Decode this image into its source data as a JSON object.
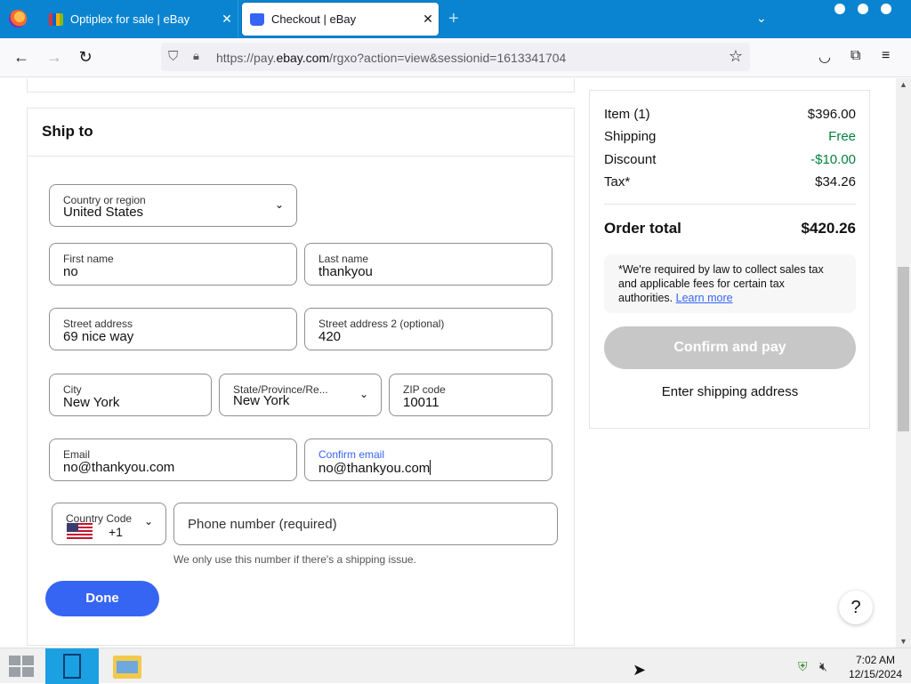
{
  "browser": {
    "tabs": [
      {
        "title": "Optiplex for sale | eBay",
        "close": "✕"
      },
      {
        "title": "Checkout | eBay",
        "close": "✕"
      }
    ],
    "new_tab": "+",
    "url_prefix": "https://pay.",
    "url_domain": "ebay.com",
    "url_suffix": "/rgxo?action=view&sessionid=1613341704"
  },
  "ship_to": {
    "heading": "Ship to",
    "country": {
      "label": "Country or region",
      "value": "United States"
    },
    "first_name": {
      "label": "First name",
      "value": "no"
    },
    "last_name": {
      "label": "Last name",
      "value": "thankyou"
    },
    "street": {
      "label": "Street address",
      "value": "69 nice way"
    },
    "street2": {
      "label": "Street address 2 (optional)",
      "value": "420"
    },
    "city": {
      "label": "City",
      "value": "New York"
    },
    "state": {
      "label": "State/Province/Re...",
      "value": "New York"
    },
    "zip": {
      "label": "ZIP code",
      "value": "10011"
    },
    "email": {
      "label": "Email",
      "value": "no@thankyou.com"
    },
    "confirm_email": {
      "label": "Confirm email",
      "value": "no@thankyou.com"
    },
    "country_code": {
      "label": "Country Code",
      "value": "+1"
    },
    "phone": {
      "placeholder": "Phone number (required)"
    },
    "phone_note": "We only use this number if there's a shipping issue.",
    "done": "Done"
  },
  "summary": {
    "item_label": "Item (1)",
    "item_value": "$396.00",
    "shipping_label": "Shipping",
    "shipping_value": "Free",
    "discount_label": "Discount",
    "discount_value": "-$10.00",
    "tax_label": "Tax*",
    "tax_value": "$34.26",
    "total_label": "Order total",
    "total_value": "$420.26",
    "tax_note": "*We're required by law to collect sales tax and applicable fees for certain tax authorities.",
    "learn_more": "Learn more",
    "confirm_button": "Confirm and pay",
    "enter_address": "Enter shipping address"
  },
  "help_button": "?",
  "taskbar": {
    "time": "7:02 AM",
    "date": "12/15/2024"
  },
  "colors": {
    "accent": "#3665f3",
    "green": "#05823f",
    "tabbar": "#0a84d0"
  }
}
